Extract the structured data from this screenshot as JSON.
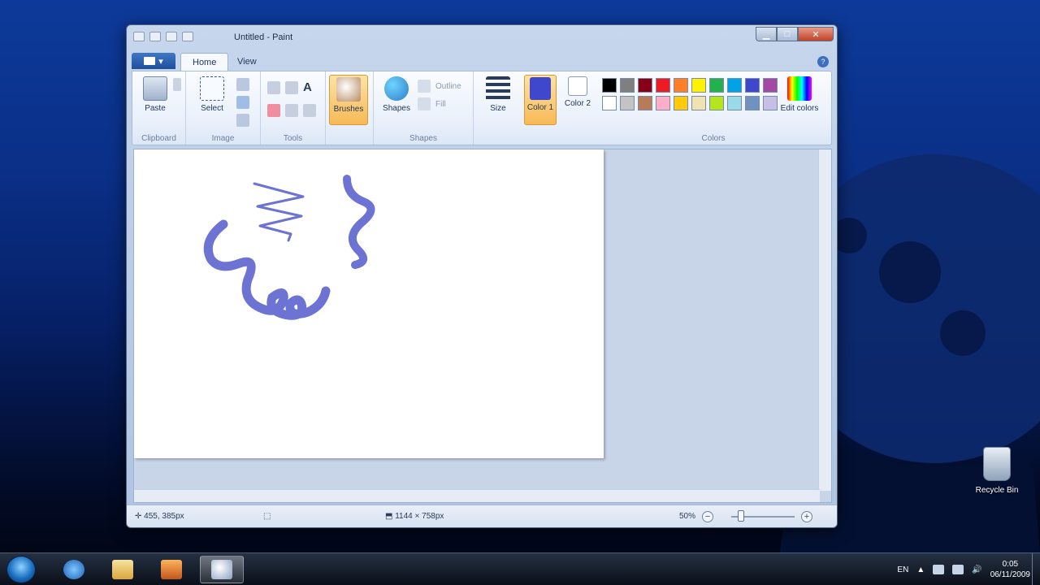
{
  "window": {
    "title": "Untitled - Paint",
    "tabs": [
      {
        "label": "Home"
      },
      {
        "label": "View"
      }
    ]
  },
  "ribbon": {
    "groups": {
      "clipboard": "Clipboard",
      "image": "Image",
      "tools": "Tools",
      "shapes": "Shapes",
      "colors": "Colors"
    },
    "buttons": {
      "paste": "Paste",
      "select": "Select",
      "brushes": "Brushes",
      "shapes": "Shapes",
      "outline": "Outline",
      "fill": "Fill",
      "size": "Size",
      "color1": "Color 1",
      "color2": "Color 2",
      "edit_colors": "Edit colors"
    },
    "palette_row1": [
      "#000000",
      "#7f7f7f",
      "#880015",
      "#ed1c24",
      "#ff7f27",
      "#fff200",
      "#22b14c",
      "#00a2e8",
      "#3f48cc",
      "#a349a4"
    ],
    "palette_row2": [
      "#ffffff",
      "#c3c3c3",
      "#b97a57",
      "#ffaec9",
      "#ffc90e",
      "#efe4b0",
      "#b5e61d",
      "#99d9ea",
      "#7092be",
      "#c8bfe7"
    ],
    "color1": "#3f48cc",
    "color2": "#ffffff"
  },
  "status": {
    "cursor_pos": "455, 385px",
    "canvas_size": "1144 × 758px",
    "zoom": "50%"
  },
  "desktop": {
    "recycle_bin": "Recycle Bin"
  },
  "taskbar": {
    "tray_lang": "EN",
    "time": "0:05",
    "date": "06/11/2009"
  }
}
